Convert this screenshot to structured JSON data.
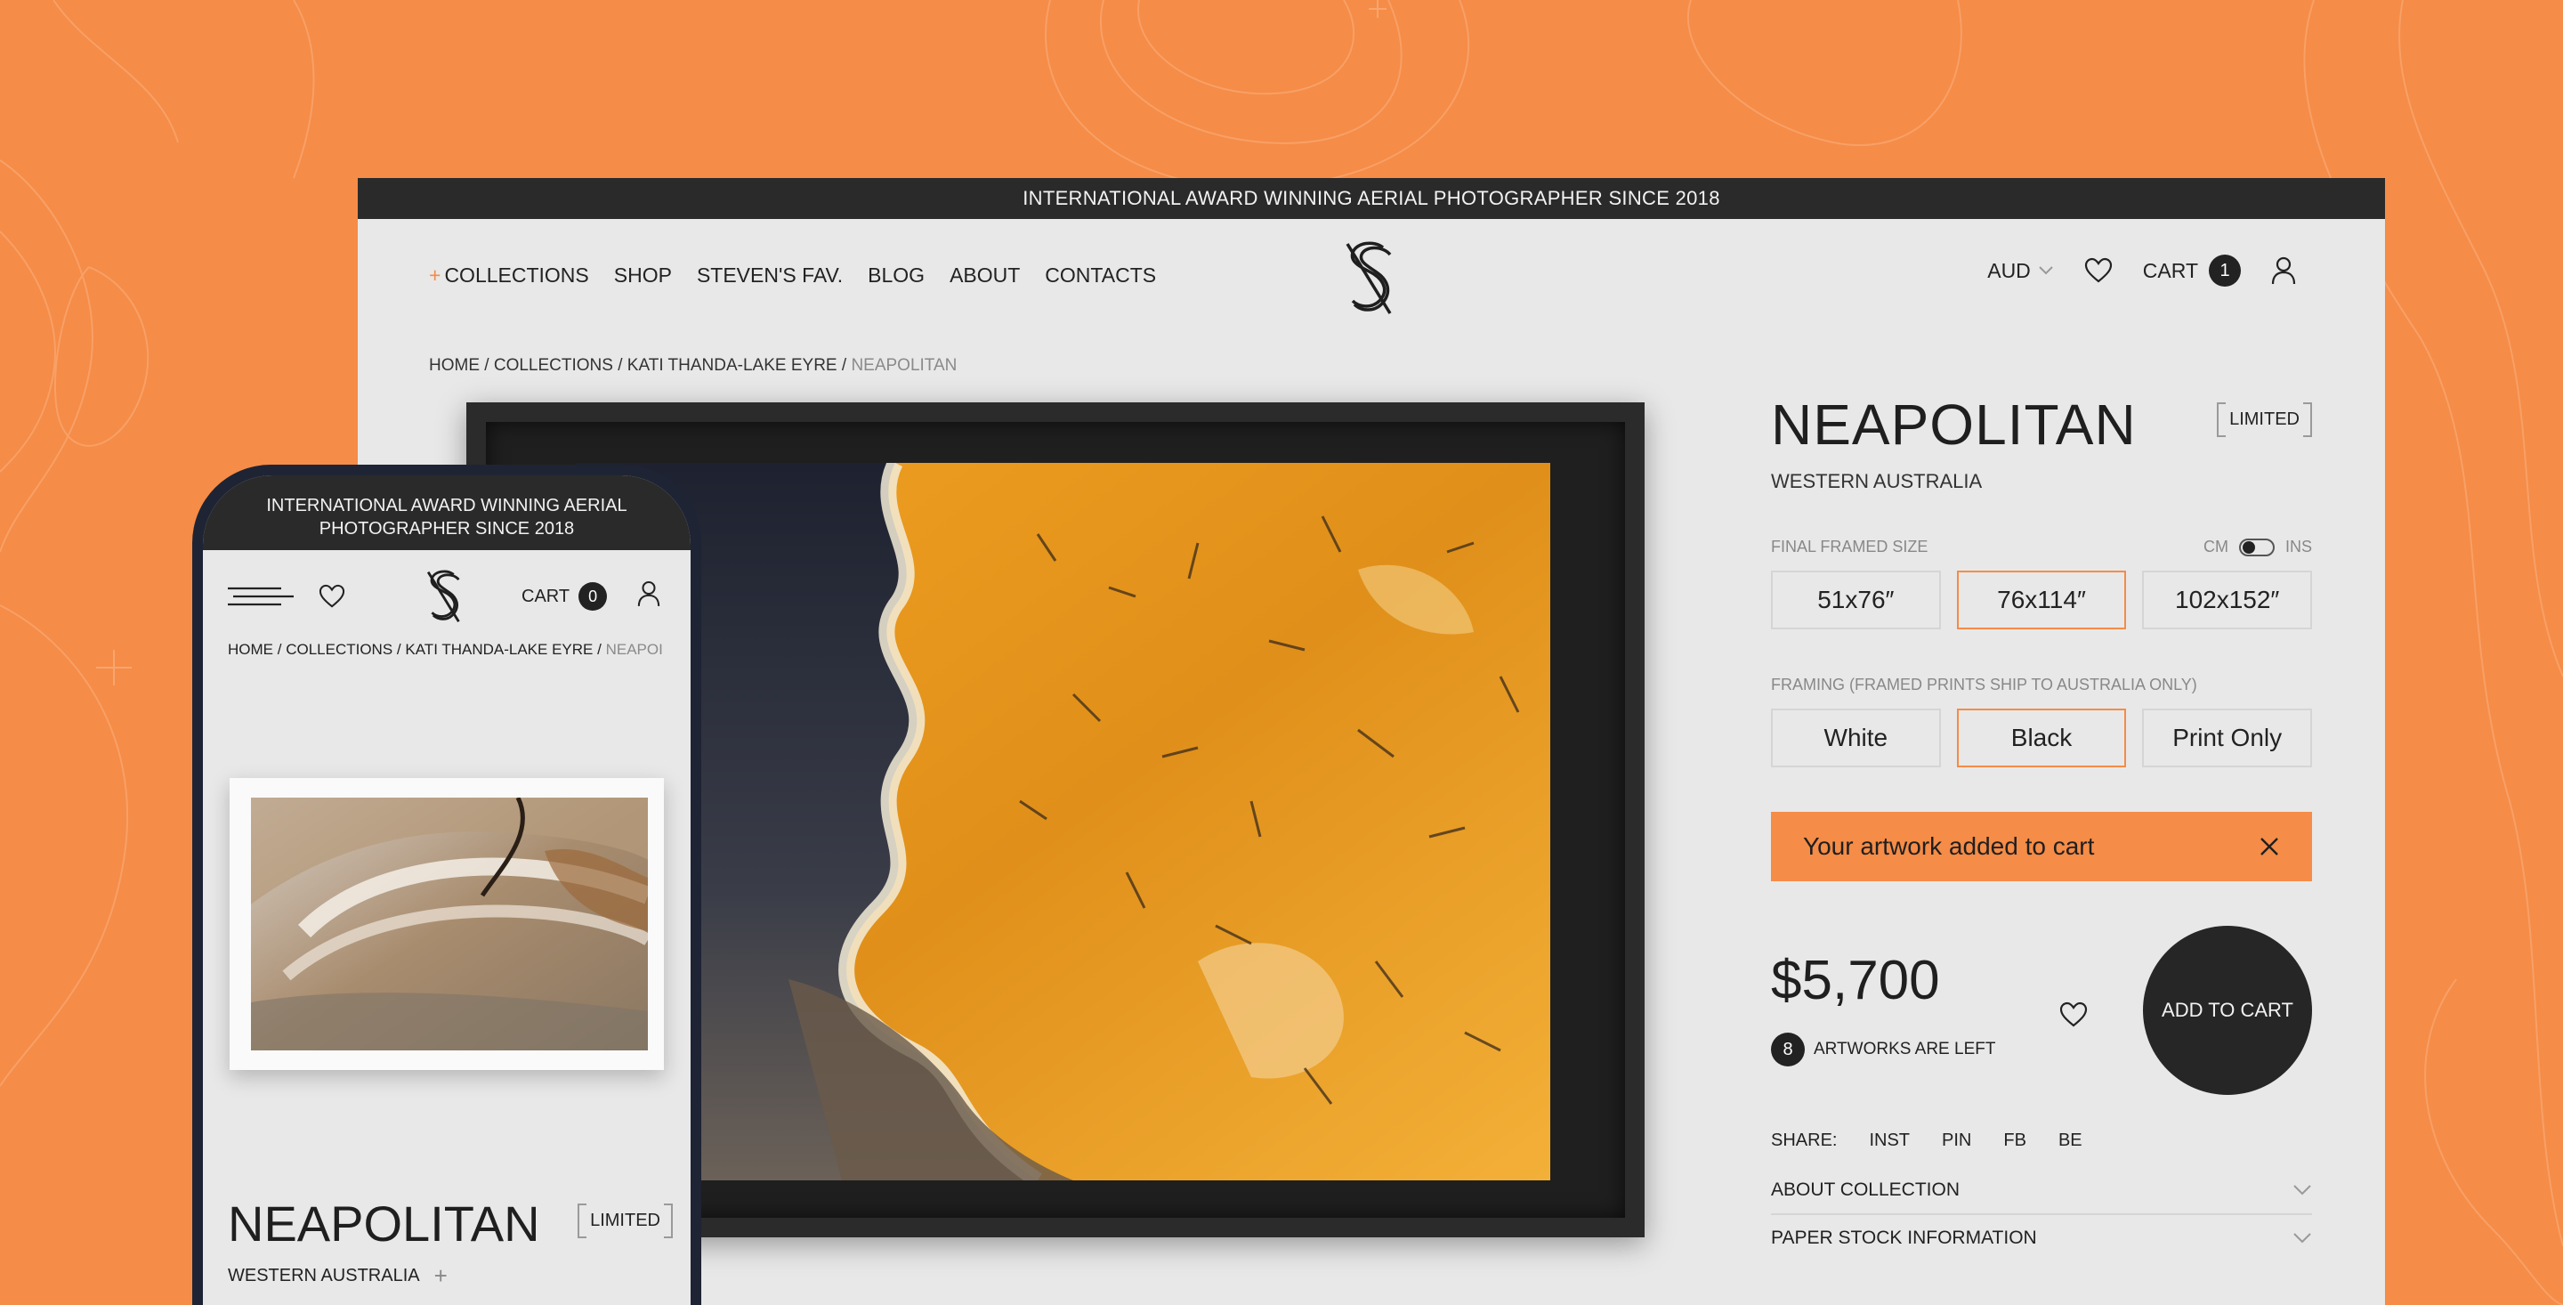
{
  "colors": {
    "accent": "#f58c47",
    "dark": "#262626",
    "page_bg": "#e8e8e8"
  },
  "desktop": {
    "announcement": "INTERNATIONAL AWARD WINNING AERIAL PHOTOGRAPHER SINCE 2018",
    "nav": {
      "items": [
        "COLLECTIONS",
        "SHOP",
        "STEVEN'S FAV.",
        "BLOG",
        "ABOUT",
        "CONTACTS"
      ],
      "plus": "+",
      "currency": "AUD",
      "cart_label": "CART",
      "cart_count": "1"
    },
    "breadcrumb": {
      "home": "HOME",
      "sep": "/",
      "collections": "COLLECTIONS",
      "collection": "KATI THANDA-LAKE EYRE",
      "current": "NEAPOLITAN"
    },
    "product": {
      "title": "NEAPOLITAN",
      "badge": "LIMITED",
      "region": "WESTERN AUSTRALIA",
      "size_label": "FINAL FRAMED SIZE",
      "unit_cm": "CM",
      "unit_ins": "INS",
      "sizes": [
        "51x76″",
        "76x114″",
        "102x152″"
      ],
      "selected_size": "76x114″",
      "framing_label": "FRAMING (FRAMED PRINTS SHIP TO AUSTRALIA ONLY)",
      "framing": [
        "White",
        "Black",
        "Print Only"
      ],
      "selected_framing": "Black",
      "toast": "Your artwork added to cart",
      "price": "$5,700",
      "left_count": "8",
      "left_text": "ARTWORKS ARE LEFT",
      "add_to_cart": "ADD TO CART",
      "share_label": "SHARE:",
      "share": [
        "INST",
        "PIN",
        "FB",
        "BE"
      ],
      "accordions": [
        "ABOUT COLLECTION",
        "PAPER STOCK INFORMATION"
      ]
    }
  },
  "mobile": {
    "announcement": "INTERNATIONAL AWARD WINNING AERIAL PHOTOGRAPHER SINCE 2018",
    "cart_label": "CART",
    "cart_count": "0",
    "breadcrumb": {
      "home": "HOME",
      "sep": "/",
      "collections": "COLLECTIONS",
      "collection": "KATI THANDA-LAKE EYRE",
      "current": "NEAPOI"
    },
    "title": "NEAPOLITAN",
    "badge": "LIMITED",
    "region": "WESTERN AUSTRALIA",
    "region_plus": "+"
  },
  "icons": [
    "heart-icon",
    "user-icon",
    "chevron-down-icon",
    "close-icon",
    "menu-icon",
    "logo-mark"
  ]
}
